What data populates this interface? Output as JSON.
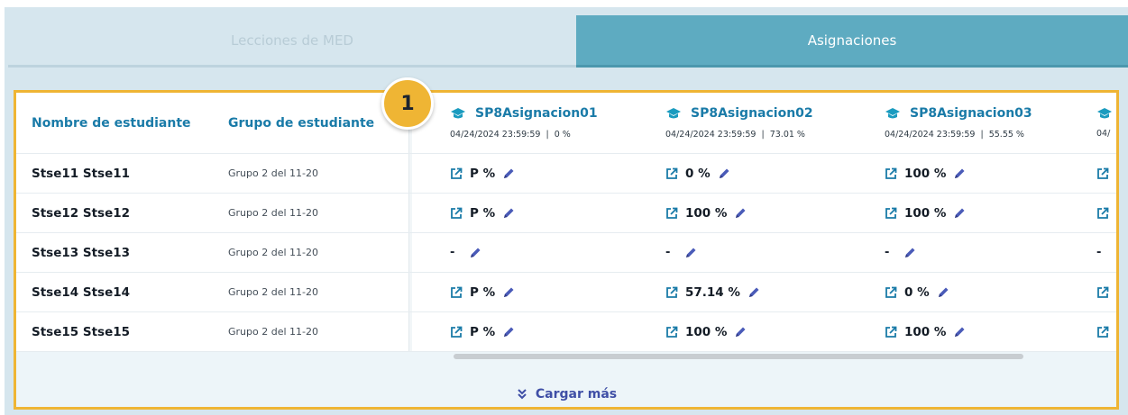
{
  "tabs": [
    {
      "label": "Lecciones de MED",
      "active": false
    },
    {
      "label": "Asignaciones",
      "active": true
    }
  ],
  "badge": "1",
  "table": {
    "col_name": "Nombre de estudiante",
    "col_group": "Grupo de estudiante",
    "assignments": [
      {
        "title": "SP8Asignacion01",
        "meta": "04/24/2024 23:59:59  |  0 %"
      },
      {
        "title": "SP8Asignacion02",
        "meta": "04/24/2024 23:59:59  |  73.01 %"
      },
      {
        "title": "SP8Asignacion03",
        "meta": "04/24/2024 23:59:59  |  55.55 %"
      },
      {
        "title": "",
        "meta": "04/"
      }
    ],
    "rows": [
      {
        "name": "Stse11 Stse11",
        "group": "Grupo 2 del 11-20",
        "scores": [
          "P %",
          "0 %",
          "100 %",
          ""
        ]
      },
      {
        "name": "Stse12 Stse12",
        "group": "Grupo 2 del 11-20",
        "scores": [
          "P %",
          "100 %",
          "100 %",
          ""
        ]
      },
      {
        "name": "Stse13 Stse13",
        "group": "Grupo 2 del 11-20",
        "scores": [
          "-",
          "-",
          "-",
          "-"
        ]
      },
      {
        "name": "Stse14 Stse14",
        "group": "Grupo 2 del 11-20",
        "scores": [
          "P %",
          "57.14 %",
          "0 %",
          ""
        ]
      },
      {
        "name": "Stse15 Stse15",
        "group": "Grupo 2 del 11-20",
        "scores": [
          "P %",
          "100 %",
          "100 %",
          ""
        ]
      }
    ]
  },
  "load_more": "Cargar más",
  "colors": {
    "accent": "#1a7ba8",
    "tab_active": "#5eabc1",
    "highlight": "#efb534",
    "icon": "#3f4fa6"
  },
  "icons": {
    "header": "graduation-cap-icon",
    "open": "external-link-icon",
    "edit": "pencil-icon",
    "more": "double-chevron-down-icon"
  }
}
